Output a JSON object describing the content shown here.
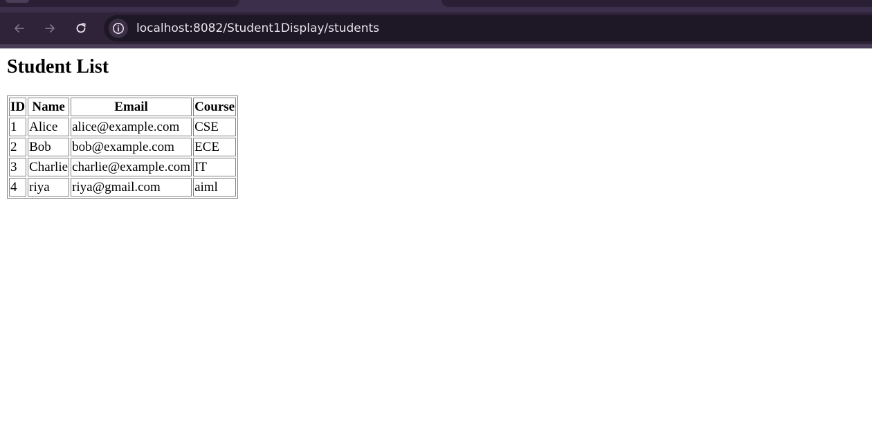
{
  "browser": {
    "url": "localhost:8082/Student1Display/students",
    "back_icon": "arrow-left-icon",
    "forward_icon": "arrow-right-icon",
    "reload_icon": "reload-icon",
    "site_info_icon": "info-icon"
  },
  "page": {
    "title": "Student List"
  },
  "table": {
    "headers": [
      "ID",
      "Name",
      "Email",
      "Course"
    ],
    "rows": [
      [
        "1",
        "Alice",
        "alice@example.com",
        "CSE"
      ],
      [
        "2",
        "Bob",
        "bob@example.com",
        "ECE"
      ],
      [
        "3",
        "Charlie",
        "charlie@example.com",
        "IT"
      ],
      [
        "4",
        "riya",
        "riya@gmail.com",
        "aiml"
      ]
    ]
  },
  "colors": {
    "chrome_background": "#3c2f4b",
    "omnibox_background": "#1e1726",
    "page_background": "#ffffff",
    "table_border": "#808080"
  }
}
